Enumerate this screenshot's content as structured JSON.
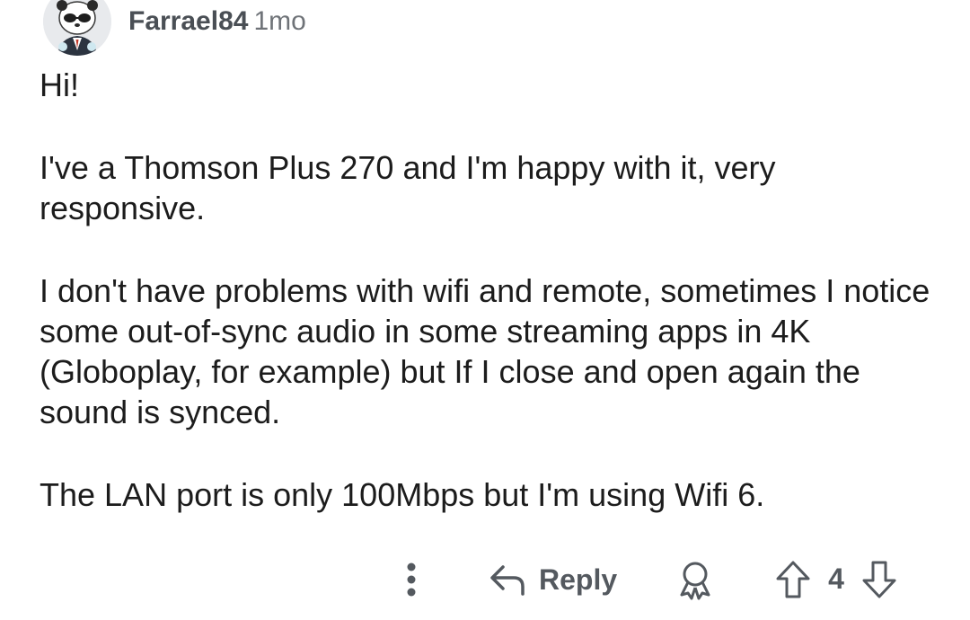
{
  "comment": {
    "username": "Farrael84",
    "age": "1mo",
    "paragraphs": [
      "Hi!",
      "I've a Thomson Plus 270 and I'm happy with it, very responsive.",
      "I don't have problems with wifi and remote, sometimes I notice some out-of-sync audio in some streaming apps in 4K (Globoplay, for example) but If I close and open again the sound is synced.",
      "The LAN port is only 100Mbps but I'm using Wifi 6."
    ]
  },
  "actions": {
    "more_icon": "vertical-dots-icon",
    "reply_icon": "reply-arrow-icon",
    "reply_label": "Reply",
    "award_icon": "award-icon",
    "upvote_icon": "upvote-arrow-icon",
    "score": "4",
    "downvote_icon": "downvote-arrow-icon"
  },
  "colors": {
    "text": "#1c1c1c",
    "meta": "#6f7378",
    "icon": "#54595f"
  }
}
